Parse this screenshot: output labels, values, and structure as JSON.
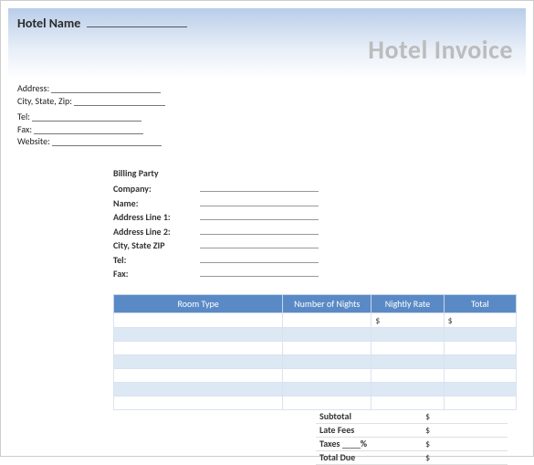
{
  "header": {
    "hotel_name_label": "Hotel Name",
    "invoice_title": "Hotel Invoice"
  },
  "address": {
    "address_label": "Address:",
    "csz_label": "City, State, Zip:",
    "tel_label": "Tel:",
    "fax_label": "Fax:",
    "website_label": "Website:"
  },
  "billing": {
    "heading": "Billing Party",
    "company_label": "Company:",
    "name_label": "Name:",
    "addr1_label": "Address Line 1:",
    "addr2_label": "Address Line 2:",
    "csz_label": "City, State ZIP",
    "tel_label": "Tel:",
    "fax_label": "Fax:"
  },
  "table": {
    "headers": {
      "room_type": "Room Type",
      "nights": "Number of Nights",
      "rate": "Nightly Rate",
      "total": "Total"
    },
    "currency": "$"
  },
  "totals": {
    "subtotal_label": "Subtotal",
    "latefees_label": "Late Fees",
    "taxes_label_prefix": "Taxes",
    "taxes_label_suffix": "%",
    "totaldue_label": "Total Due",
    "currency": "$"
  }
}
